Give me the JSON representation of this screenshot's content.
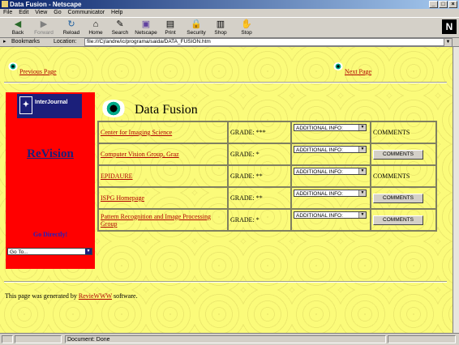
{
  "window": {
    "title": "Data Fusion - Netscape",
    "controls": [
      "_",
      "□",
      "×"
    ]
  },
  "menu": [
    "File",
    "Edit",
    "View",
    "Go",
    "Communicator",
    "Help"
  ],
  "toolbar": {
    "buttons": [
      {
        "label": "Back",
        "icon": "back-arrow-icon",
        "glyph": "◀"
      },
      {
        "label": "Forward",
        "icon": "forward-arrow-icon",
        "glyph": "▶"
      },
      {
        "label": "Reload",
        "icon": "reload-icon",
        "glyph": "↻"
      },
      {
        "label": "Home",
        "icon": "home-icon",
        "glyph": "⌂"
      },
      {
        "label": "Search",
        "icon": "search-icon",
        "glyph": "✎"
      },
      {
        "label": "Netscape",
        "icon": "netscape-icon",
        "glyph": "▣"
      },
      {
        "label": "Print",
        "icon": "print-icon",
        "glyph": "▤"
      },
      {
        "label": "Security",
        "icon": "lock-icon",
        "glyph": "🔒"
      },
      {
        "label": "Shop",
        "icon": "shop-icon",
        "glyph": "▥"
      },
      {
        "label": "Stop",
        "icon": "stop-icon",
        "glyph": "✋"
      }
    ],
    "logo": "N"
  },
  "location": {
    "bookmarks_label": "Bookmarks",
    "location_label": "Location:",
    "url": "file:///C|/andre/ic/programa/saida/DATA_FUSION.htm"
  },
  "page": {
    "prev_link": "Previous Page",
    "next_link": "Next Page",
    "title": "Data Fusion",
    "sidebar": {
      "badge": "InterJournal",
      "revision": "ReVision",
      "go_directly": "Go Directly!",
      "goto_value": "Go To..."
    },
    "rows": [
      {
        "name": "Center for Imaging Science",
        "grade": "GRADE: ***",
        "info": "ADDITIONAL INFO:",
        "comments": "COMMENTS",
        "comments_is_button": false
      },
      {
        "name": "Computer Vision Group, Graz",
        "grade": "GRADE: *",
        "info": "ADDITIONAL INFO:",
        "comments": "COMMENTS",
        "comments_is_button": true
      },
      {
        "name": "EPIDAURE",
        "grade": "GRADE: **",
        "info": "ADDITIONAL INFO:",
        "comments": "COMMENTS",
        "comments_is_button": false
      },
      {
        "name": "ISPG Homepage",
        "grade": "GRADE: **",
        "info": "ADDITIONAL INFO:",
        "comments": "COMMENTS",
        "comments_is_button": true
      },
      {
        "name": "Pattern Recognition and Image Processing Group",
        "grade": "GRADE: *",
        "info": "ADDITIONAL INFO:",
        "comments": "COMMENTS",
        "comments_is_button": true
      }
    ],
    "footer": {
      "before": "This page was generated by ",
      "link": "RevieWWW",
      "after": " software."
    }
  },
  "status": {
    "text": "Document: Done"
  },
  "colors": {
    "page_bg": "#fbfb7a",
    "sidebar_bg": "#ff0000",
    "link": "#b00000",
    "title_bar": "#0a246a"
  }
}
